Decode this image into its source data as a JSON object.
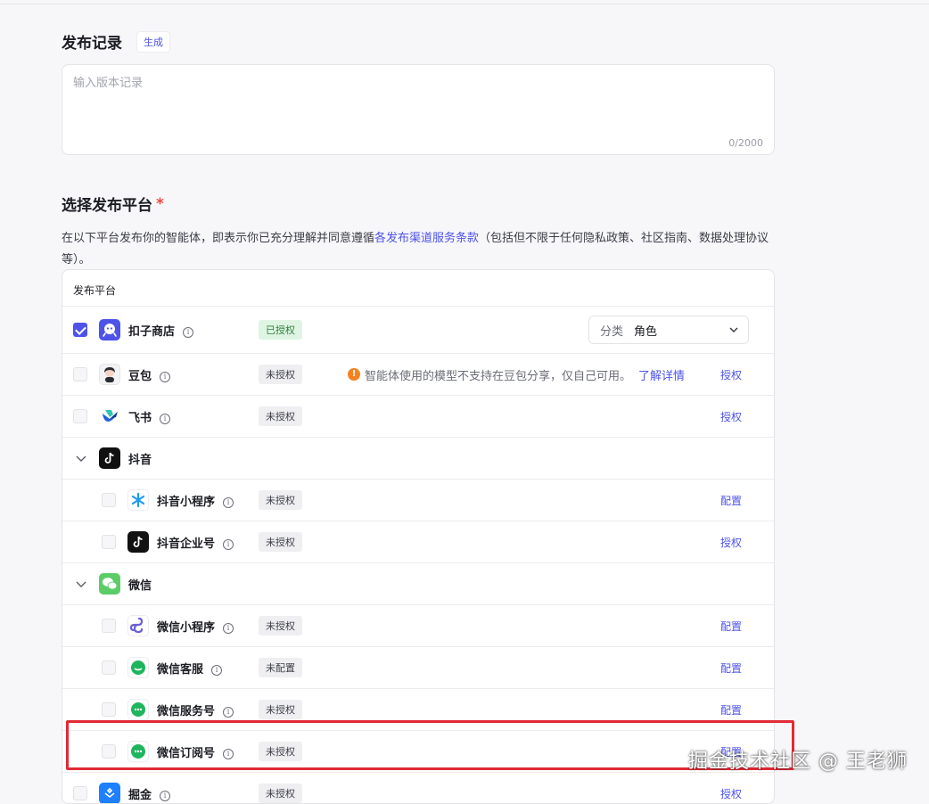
{
  "release": {
    "title": "发布记录",
    "generate_label": "生成",
    "placeholder": "输入版本记录",
    "counter": "0/2000"
  },
  "platforms_section": {
    "title": "选择发布平台",
    "required_mark": "*",
    "desc_before": "在以下平台发布你的智能体，即表示你已充分理解并同意遵循",
    "desc_link": "各发布渠道服务条款",
    "desc_after": "（包括但不限于任何隐私政策、社区指南、数据处理协议等）。"
  },
  "table": {
    "header": "发布平台",
    "rows": [
      {
        "name": "扣子商店",
        "status": "已授权",
        "checked": true,
        "icon": "coze-store-icon",
        "category_label": "分类",
        "category_value": "角色"
      },
      {
        "name": "豆包",
        "status": "未授权",
        "action": "授权",
        "icon": "doubao-icon",
        "warning": "智能体使用的模型不支持在豆包分享，仅自己可用。",
        "warning_link": "了解详情"
      },
      {
        "name": "飞书",
        "status": "未授权",
        "action": "授权",
        "icon": "feishu-icon"
      },
      {
        "name": "抖音",
        "group": true,
        "icon": "douyin-icon"
      },
      {
        "name": "抖音小程序",
        "status": "未授权",
        "action": "配置",
        "icon": "douyin-miniapp-icon"
      },
      {
        "name": "抖音企业号",
        "status": "未授权",
        "action": "授权",
        "icon": "douyin-enterprise-icon"
      },
      {
        "name": "微信",
        "group": true,
        "icon": "wechat-icon"
      },
      {
        "name": "微信小程序",
        "status": "未授权",
        "action": "配置",
        "icon": "wechat-miniapp-icon"
      },
      {
        "name": "微信客服",
        "status": "未配置",
        "action": "配置",
        "icon": "wechat-service-icon"
      },
      {
        "name": "微信服务号",
        "status": "未授权",
        "action": "配置",
        "icon": "wechat-official-service-icon"
      },
      {
        "name": "微信订阅号",
        "status": "未授权",
        "action": "配置",
        "icon": "wechat-subscription-icon"
      },
      {
        "name": "掘金",
        "status": "未授权",
        "action": "授权",
        "icon": "juejin-icon"
      }
    ]
  },
  "watermark": "掘金技术社区 @ 王老狮",
  "colors": {
    "accent": "#4d53e8",
    "highlight": "#e12a35",
    "warning": "#f58220",
    "authorized_bg": "#dff5e3"
  }
}
